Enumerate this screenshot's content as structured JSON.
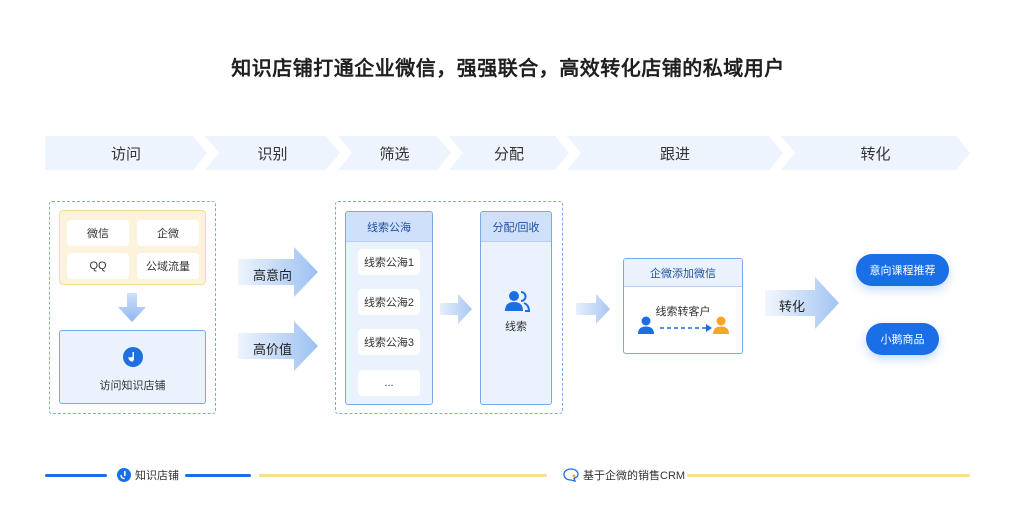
{
  "title": "知识店铺打通企业微信，强强联合，高效转化店铺的私域用户",
  "steps": [
    "访问",
    "识别",
    "筛选",
    "分配",
    "跟进",
    "转化"
  ],
  "sources": {
    "chips": [
      "微信",
      "企微",
      "QQ",
      "公域流量"
    ]
  },
  "visit": {
    "icon": "note-icon",
    "label": "访问知识店铺"
  },
  "identify": {
    "labels": [
      "高意向",
      "高价值"
    ]
  },
  "leads": {
    "header": "线索公海",
    "items": [
      "线索公海1",
      "线索公海2",
      "线索公海3",
      "..."
    ]
  },
  "assign": {
    "header": "分配/回收",
    "icon": "users-icon",
    "label": "线索"
  },
  "wecom": {
    "header": "企微添加微信",
    "label": "线索转客户"
  },
  "convert": {
    "label": "转化",
    "buttons": [
      "意向课程推荐",
      "小鹅商品"
    ]
  },
  "footer": {
    "left": "知识店铺",
    "right": "基于企微的销售CRM"
  },
  "colors": {
    "primary": "#1b6fe6",
    "light": "#eaf2fd",
    "source_bg": "#fdf3dc",
    "accent_yellow": "#f7e08a"
  }
}
